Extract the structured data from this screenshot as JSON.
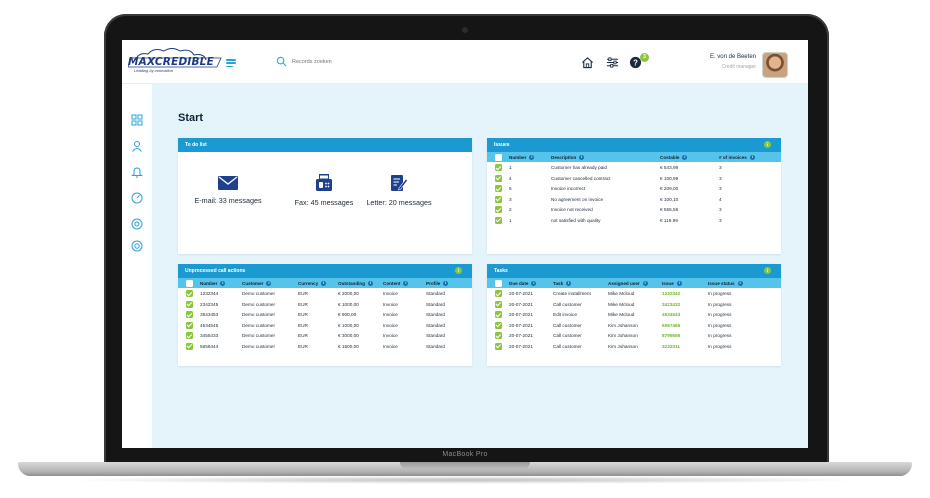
{
  "device": {
    "label": "MacBook Pro"
  },
  "header": {
    "logo_text": "MAXCREDIBLE",
    "logo_tagline": "Leading by innovation",
    "search_placeholder": "Records zoeken",
    "help_badge": "3",
    "user_name": "E. von de Beeten",
    "user_role": "Credit manager"
  },
  "page": {
    "title": "Start"
  },
  "todo": {
    "title": "To do list",
    "items": [
      {
        "icon": "mail-icon",
        "label": "E-mail: 33 messages"
      },
      {
        "icon": "fax-icon",
        "label": "Fax: 45 messages"
      },
      {
        "icon": "letter-icon",
        "label": "Letter: 20 messages"
      }
    ]
  },
  "issues": {
    "title": "Issues",
    "columns": [
      "Number",
      "Description",
      "Costable",
      "# of invoices"
    ],
    "rows": [
      [
        "1",
        "Customer has already paid",
        "€ 543,99",
        "3"
      ],
      [
        "4",
        "Customer cancelled contract",
        "€ 100,99",
        "3"
      ],
      [
        "5",
        "Invoice incorrect",
        "€ 209,00",
        "3"
      ],
      [
        "3",
        "No agreement on invoice",
        "€ 100,10",
        "4"
      ],
      [
        "2",
        "Invoice not received",
        "€ 555,55",
        "3"
      ],
      [
        "1",
        "not satisfied with quality",
        "€ 119,99",
        "3"
      ]
    ]
  },
  "calls": {
    "title": "Unprocessed call actions",
    "columns": [
      "Number",
      "Customer",
      "Currency",
      "Outstanding",
      "Content",
      "Profile"
    ],
    "rows": [
      [
        "1232344",
        "Demo customer",
        "EUR",
        "€ 2000,00",
        "Invoice",
        "Standard"
      ],
      [
        "2342345",
        "Demo customer",
        "EUR",
        "€ 1000,00",
        "Invoice",
        "Standard"
      ],
      [
        "3543453",
        "Demo customer",
        "EUR",
        "€   900,00",
        "Invoice",
        "Standard"
      ],
      [
        "4534545",
        "Demo customer",
        "EUR",
        "€ 1000,00",
        "Invoice",
        "Standard"
      ],
      [
        "3455433",
        "Demo customer",
        "EUR",
        "€ 3000,00",
        "Invoice",
        "Standard"
      ],
      [
        "5656444",
        "Demo customer",
        "EUR",
        "€ 1500,00",
        "Invoice",
        "Standard"
      ]
    ]
  },
  "tasks": {
    "title": "Tasks",
    "columns": [
      "Due date",
      "Task",
      "Assigned user",
      "Issue",
      "Issue status"
    ],
    "rows": [
      [
        "20-07-2021",
        "Create installment",
        "Mike Mcloud",
        "1232342",
        "In progress"
      ],
      [
        "20-07-2021",
        "Call customer",
        "Mike Mcloud",
        "3423432",
        "In progress"
      ],
      [
        "20-07-2021",
        "Edit invoice",
        "Mike Mcloud",
        "4534543",
        "In progress"
      ],
      [
        "20-07-2021",
        "Call customer",
        "Kim Johanson",
        "6067465",
        "In progress"
      ],
      [
        "20-07-2021",
        "Call customer",
        "Kim Johanson",
        "8795555",
        "In progress"
      ],
      [
        "20-07-2021",
        "Call customer",
        "Kim Johanson",
        "3232311",
        "In progress"
      ]
    ]
  },
  "colors": {
    "primary": "#1b9ad1",
    "header_row": "#55c3ea",
    "accent": "#8cc63f",
    "background": "#e4f4fa"
  }
}
